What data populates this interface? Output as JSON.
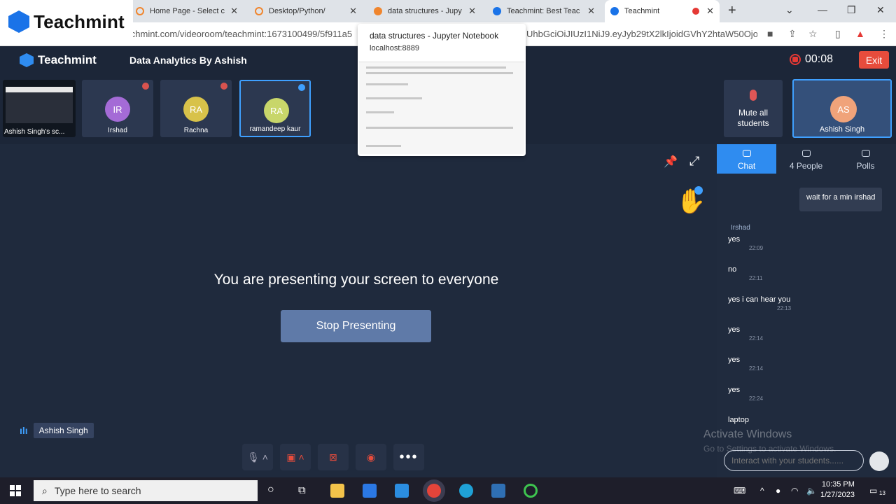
{
  "browser": {
    "tabs": [
      {
        "label": "Home Page - Select c",
        "color": "#f0852d"
      },
      {
        "label": "Desktop/Python/",
        "color": "#f0852d"
      },
      {
        "label": "data structures - Jupy",
        "color": "#f0852d"
      },
      {
        "label": "Teachmint: Best Teac",
        "color": "#1a73e8"
      },
      {
        "label": "Teachmint",
        "color": "#1a73e8"
      }
    ],
    "url_left": "video.teachmint.com/videoroom/teachmint:1673100499/5f911a5",
    "url_right": "UhbGciOiJIUzI1NiJ9.eyJyb29tX2lkIjoidGVhY2htaW50Ojo...",
    "brand_overlay": "Teachmint"
  },
  "tab_preview": {
    "title": "data structures - Jupyter Notebook",
    "url": "localhost:8889"
  },
  "app": {
    "logo": "Teachmint",
    "class_title": "Data Analytics By Ashish",
    "timer": "00:08",
    "exit_label": "Exit",
    "mute_all": "Mute all students"
  },
  "participants": [
    {
      "name": "Ashish Singh's sc...",
      "kind": "screen"
    },
    {
      "name": "Irshad",
      "initials": "IR",
      "color": "#a46bd6"
    },
    {
      "name": "Rachna",
      "initials": "RA",
      "color": "#d8c24a"
    },
    {
      "name": "ramandeep kaur",
      "initials": "RA",
      "color": "#c8d66a"
    }
  ],
  "teacher": {
    "name": "Ashish Singh",
    "initials": "AS"
  },
  "stage": {
    "message": "You are presenting your screen to everyone",
    "stop_label": "Stop Presenting",
    "speaker_name": "Ashish Singh"
  },
  "chat": {
    "tabs": [
      {
        "label": "Chat"
      },
      {
        "label": "4 People"
      },
      {
        "label": "Polls"
      }
    ],
    "outgoing": "wait for a min irshad",
    "sender": "Irshad",
    "messages": [
      {
        "text": "yes",
        "time": "22:09"
      },
      {
        "text": "no",
        "time": "22:11"
      },
      {
        "text": "yes i can hear you",
        "time": "22:13"
      },
      {
        "text": "yes",
        "time": "22:14"
      },
      {
        "text": "yes",
        "time": "22:14"
      },
      {
        "text": "yes",
        "time": "22:24"
      },
      {
        "text": "laptop",
        "time": ""
      }
    ],
    "input_placeholder": "Interact with your students......"
  },
  "watermark": {
    "title": "Activate Windows",
    "subtitle": "Go to Settings to activate Windows."
  },
  "taskbar": {
    "search_placeholder": "Type here to search",
    "time": "10:35 PM",
    "date": "1/27/2023",
    "notification_count": "13"
  }
}
